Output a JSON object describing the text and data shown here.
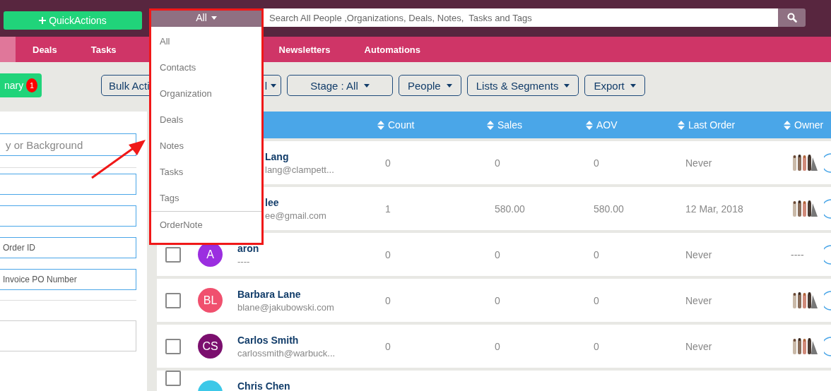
{
  "top_bar": {
    "quick_actions": "QuickActions",
    "search": {
      "category": "All",
      "placeholder": "Search All People ,Organizations, Deals, Notes,  Tasks and Tags"
    }
  },
  "nav": {
    "items": [
      {
        "selected": true
      },
      {
        "label": "Deals",
        "selected": false
      },
      {
        "label": "Tasks",
        "selected": false
      },
      {
        "label": "Newsletters",
        "selected": false
      },
      {
        "label": "Automations",
        "selected": false
      }
    ]
  },
  "toolbar": {
    "summary": {
      "label": "nary",
      "badge": "1"
    },
    "buttons": [
      {
        "label": "Bulk Acti",
        "caret": false
      },
      {
        "label": "l",
        "caret": true
      },
      {
        "label": "Stage : All",
        "caret": true
      },
      {
        "label": "People",
        "caret": true
      },
      {
        "label": "Lists & Segments",
        "caret": true
      },
      {
        "label": "Export",
        "caret": true
      }
    ]
  },
  "filters": {
    "fields": [
      {
        "kind": "search",
        "placeholder": "y or Background"
      },
      {
        "kind": "input"
      },
      {
        "kind": "input"
      },
      {
        "kind": "input",
        "placeholder": "Order ID"
      },
      {
        "kind": "input",
        "placeholder": "Invoice PO Number"
      },
      {
        "kind": "textarea"
      }
    ]
  },
  "table": {
    "columns": [
      "Count",
      "Sales",
      "AOV",
      "Last Order",
      "Owner"
    ],
    "rows": [
      {
        "covered": true,
        "name": "Lang",
        "email": "lang@clampett...",
        "count": "0",
        "sales": "0",
        "aov": "0",
        "last_order": "Never"
      },
      {
        "covered": true,
        "name": "lee",
        "email": "ee@gmail.com",
        "count": "1",
        "sales": "580.00",
        "aov": "580.00",
        "last_order": "12 Mar, 2018"
      },
      {
        "covered": false,
        "checked": false,
        "initials": "A",
        "color": "#9b2ee0",
        "name": "aron",
        "email": "----",
        "count": "0",
        "sales": "0",
        "aov": "0",
        "last_order": "Never",
        "owner": "----"
      },
      {
        "covered": false,
        "checked": false,
        "initials": "BL",
        "color": "#f0506e",
        "name": "Barbara Lane",
        "email": "blane@jakubowski.com",
        "count": "0",
        "sales": "0",
        "aov": "0",
        "last_order": "Never"
      },
      {
        "covered": false,
        "checked": false,
        "initials": "CS",
        "color": "#7b0f6e",
        "name": "Carlos Smith",
        "email": "carlossmith@warbuck...",
        "count": "0",
        "sales": "0",
        "aov": "0",
        "last_order": "Never"
      },
      {
        "covered": false,
        "checked": false,
        "partial": true,
        "color": "#3cc8e8",
        "name": "Chris Chen"
      }
    ]
  },
  "dropdown": {
    "items": [
      {
        "label": "All",
        "divider_before": false
      },
      {
        "label": "Contacts",
        "divider_before": false
      },
      {
        "label": "Organization",
        "divider_before": false
      },
      {
        "label": "Deals",
        "divider_before": false
      },
      {
        "label": "Notes",
        "divider_before": false
      },
      {
        "label": "Tasks",
        "divider_before": false
      },
      {
        "label": "Tags",
        "divider_before": false
      },
      {
        "label": "OrderNote",
        "divider_before": true
      }
    ]
  }
}
